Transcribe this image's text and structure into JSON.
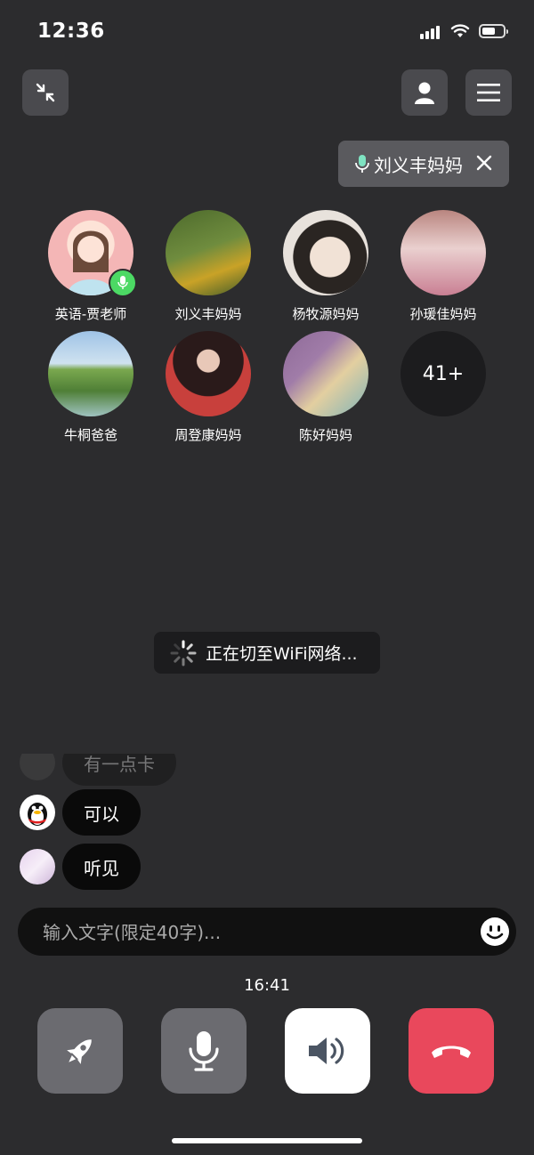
{
  "status_bar": {
    "time": "12:36"
  },
  "active_speaker": {
    "name": "刘义丰妈妈"
  },
  "participants": [
    {
      "name": "英语-贾老师",
      "mic": true,
      "colors": [
        "#f4b6b6",
        "#fde3d7"
      ]
    },
    {
      "name": "刘义丰妈妈",
      "colors": [
        "#5f7a3a",
        "#c9a227"
      ]
    },
    {
      "name": "杨牧源妈妈",
      "colors": [
        "#e8e2dc",
        "#2a2522"
      ]
    },
    {
      "name": "孙瑗佳妈妈",
      "colors": [
        "#c98f8f",
        "#ead0cf"
      ]
    },
    {
      "name": "牛桐爸爸",
      "colors": [
        "#9fc3e6",
        "#4f7f36"
      ]
    },
    {
      "name": "周登康妈妈",
      "colors": [
        "#2a1a1a",
        "#c8403c"
      ]
    },
    {
      "name": "陈好妈妈",
      "colors": [
        "#a07ca8",
        "#e3cfa0"
      ]
    }
  ],
  "more_count": "41+",
  "toast": {
    "text": "正在切至WiFi网络..."
  },
  "chat": [
    {
      "text": "有一点卡",
      "faded": true
    },
    {
      "text": "可以"
    },
    {
      "text": "听见"
    }
  ],
  "input": {
    "placeholder": "输入文字(限定40字)..."
  },
  "call_duration": "16:41",
  "colors": {
    "background": "#2c2c2e",
    "hangup": "#e9485c",
    "mic_active": "#4cd964",
    "control_gray": "#6b6b70"
  }
}
